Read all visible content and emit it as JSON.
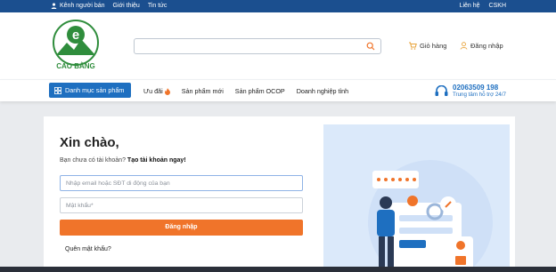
{
  "topbar": {
    "seller_channel": "Kênh người bán",
    "about": "Giới thiệu",
    "news": "Tin tức",
    "contact": "Liên hệ",
    "cskh": "CSKH"
  },
  "logo": {
    "name": "CAO BẰNG"
  },
  "search": {
    "placeholder": ""
  },
  "header": {
    "cart_label": "Giỏ hàng",
    "login_label": "Đăng nhập"
  },
  "nav": {
    "categories_label": "Danh mục sản phẩm",
    "items": [
      "Ưu đãi",
      "Sản phẩm mới",
      "Sản phẩm OCOP",
      "Doanh nghiệp tỉnh"
    ]
  },
  "hotline": {
    "number": "02063509 198",
    "support": "Trung tâm hỗ trợ 24/7"
  },
  "login_form": {
    "title": "Xin chào,",
    "prompt": "Bạn chưa có tài khoản?",
    "create_link": "Tạo tài khoản ngay!",
    "email_placeholder": "Nhập email hoặc SĐT di động của bạn",
    "password_placeholder": "Mật khẩu*",
    "submit": "Đăng nhập",
    "forgot": "Quên mật khẩu?"
  },
  "colors": {
    "topbar": "#1b4f8f",
    "primary": "#1e6fc0",
    "accent": "#f0742a",
    "brand_green": "#2f8d3c"
  }
}
